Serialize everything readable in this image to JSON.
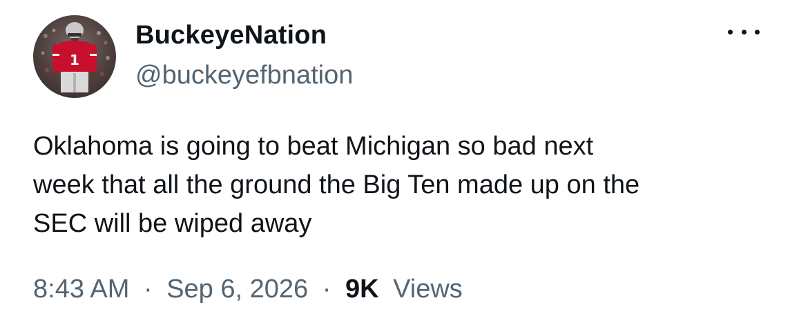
{
  "author": {
    "display_name": "BuckeyeNation",
    "handle": "@buckeyefbnation",
    "avatar_jersey_number": "1"
  },
  "tweet": {
    "text_lines": [
      "Oklahoma is going to beat Michigan so bad next",
      "week that all the ground the Big Ten made up on the",
      "SEC will be wiped away"
    ],
    "time": "8:43 AM",
    "separator": "·",
    "date": "Sep 6, 2026",
    "views_count": "9K",
    "views_label": "Views"
  },
  "icons": {
    "more": "more-options-icon"
  },
  "colors": {
    "text_primary": "#0f1419",
    "text_secondary": "#536471",
    "background": "#ffffff",
    "jersey_red": "#c8102e"
  }
}
